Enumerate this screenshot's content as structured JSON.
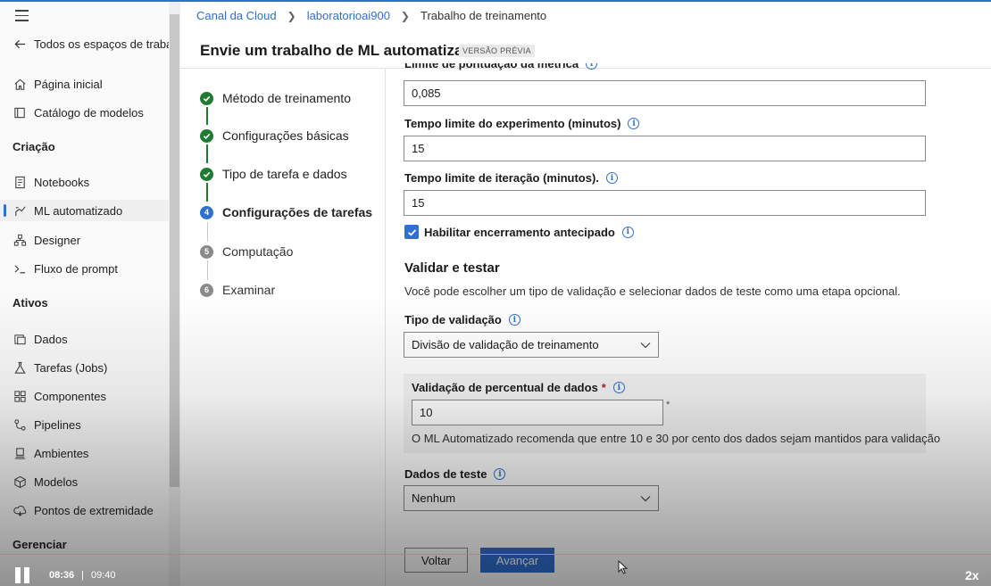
{
  "sidebar": {
    "back_label": "Todos os espaços de trabal",
    "items_top": [
      {
        "label": "Página inicial",
        "icon": "home-icon"
      },
      {
        "label": "Catálogo de modelos",
        "icon": "catalog-icon"
      }
    ],
    "section_criacao": "Criação",
    "items_criacao": [
      {
        "label": "Notebooks",
        "icon": "notebook-icon"
      },
      {
        "label": "ML automatizado",
        "icon": "automl-icon"
      },
      {
        "label": "Designer",
        "icon": "designer-icon"
      },
      {
        "label": "Fluxo de prompt",
        "icon": "prompt-flow-icon"
      }
    ],
    "section_ativos": "Ativos",
    "items_ativos": [
      {
        "label": "Dados",
        "icon": "data-icon"
      },
      {
        "label": "Tarefas (Jobs)",
        "icon": "jobs-icon"
      },
      {
        "label": "Componentes",
        "icon": "components-icon"
      },
      {
        "label": "Pipelines",
        "icon": "pipelines-icon"
      },
      {
        "label": "Ambientes",
        "icon": "environments-icon"
      },
      {
        "label": "Modelos",
        "icon": "models-icon"
      },
      {
        "label": "Pontos de extremidade",
        "icon": "endpoints-icon"
      }
    ],
    "section_gerenciar": "Gerenciar"
  },
  "breadcrumb": {
    "items": [
      "Canal da Cloud",
      "laboratorioai900",
      "Trabalho de treinamento"
    ]
  },
  "header": {
    "title": "Envie um trabalho de ML automatizado",
    "badge": "VERSÃO PRÉVIA"
  },
  "steps": [
    {
      "label": "Método de treinamento",
      "state": "done",
      "num": "1"
    },
    {
      "label": "Configurações básicas",
      "state": "done",
      "num": "2"
    },
    {
      "label": "Tipo de tarefa e dados",
      "state": "done",
      "num": "3"
    },
    {
      "label": "Configurações de tarefas",
      "state": "current",
      "num": "4"
    },
    {
      "label": "Computação",
      "state": "todo",
      "num": "5"
    },
    {
      "label": "Examinar",
      "state": "todo",
      "num": "6"
    }
  ],
  "form": {
    "metric_label": "Limite de pontuação da métrica",
    "metric_value": "0,085",
    "experiment_timeout_label": "Tempo limite do experimento (minutos)",
    "experiment_timeout_value": "15",
    "iteration_timeout_label": "Tempo limite de iteração (minutos).",
    "iteration_timeout_value": "15",
    "early_stop_label": "Habilitar encerramento antecipado",
    "early_stop_checked": true,
    "validate_title": "Validar e testar",
    "validate_desc": "Você pode escolher um tipo de validação e selecionar dados de teste como uma etapa opcional.",
    "validation_type_label": "Tipo de validação",
    "validation_type_value": "Divisão de validação de treinamento",
    "data_pct_label": "Validação de percentual de dados",
    "data_pct_required": "*",
    "data_pct_value": "10",
    "data_pct_hint": "O ML Automatizado recomenda que entre 10 e 30 por cento dos dados sejam mantidos para validação",
    "test_data_label": "Dados de teste",
    "test_data_value": "Nenhum",
    "info_glyph": "i"
  },
  "buttons": {
    "back": "Voltar",
    "next": "Avançar"
  },
  "player": {
    "current_time": "08:36",
    "separator": "|",
    "total_time": "09:40",
    "speed": "2x",
    "progress": 0.889
  },
  "colors": {
    "accent": "#2f6fd0",
    "done": "#1f7a33",
    "progress": "#e9782d"
  }
}
